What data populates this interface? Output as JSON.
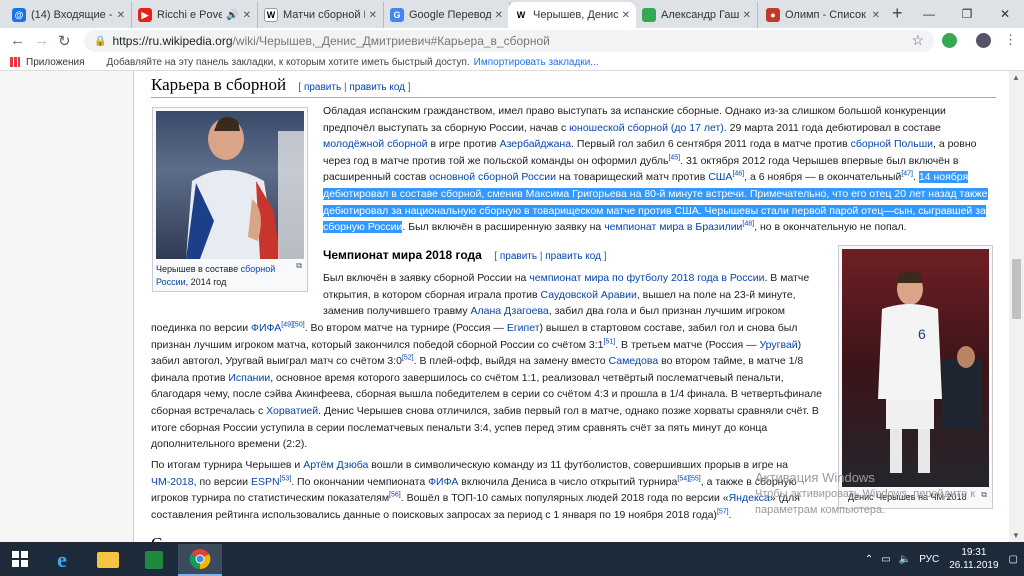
{
  "tabs": [
    {
      "title": "(14) Входящие - П",
      "favicon_color": "#1a73e8"
    },
    {
      "title": "Ricchi e Poveri",
      "favicon_color": "#e62117"
    },
    {
      "title": "Матчи сборной Р",
      "favicon_color": "#ffffff"
    },
    {
      "title": "Google Переводч",
      "favicon_color": "#4285f4"
    },
    {
      "title": "Черышев, Денис Д",
      "favicon_color": "#ffffff",
      "active": true
    },
    {
      "title": "Александр Гашин",
      "favicon_color": "#34a853"
    },
    {
      "title": "Олимп - Список с",
      "favicon_color": "#c0392b"
    }
  ],
  "toolbar": {
    "url_host": "https://ru.wikipedia.org",
    "url_path": "/wiki/Черышев,_Денис_Дмитриевич#Карьера_в_сборной"
  },
  "bookmarks": {
    "apps_label": "Приложения",
    "hint": "Добавляйте на эту панель закладки, к которым хотите иметь быстрый доступ.",
    "import_link": "Импортировать закладки..."
  },
  "article": {
    "section_title": "Карьера в сборной",
    "edit_label": "править",
    "edit_code_label": "править код",
    "photo1_caption_a": "Черышев в составе ",
    "photo1_caption_link": "сборной России",
    "photo1_caption_b": ", 2014 год",
    "photo2_caption": "Денис Черышев на ЧМ 2018",
    "subsection_title": "Чемпионат мира 2018 года"
  },
  "activation": {
    "line1": "Активация Windows",
    "line2": "Чтобы активировать Windows, перейдите к",
    "line3": "параметрам компьютера."
  },
  "taskbar": {
    "language": "РУС",
    "time": "19:31",
    "date": "26.11.2019"
  }
}
